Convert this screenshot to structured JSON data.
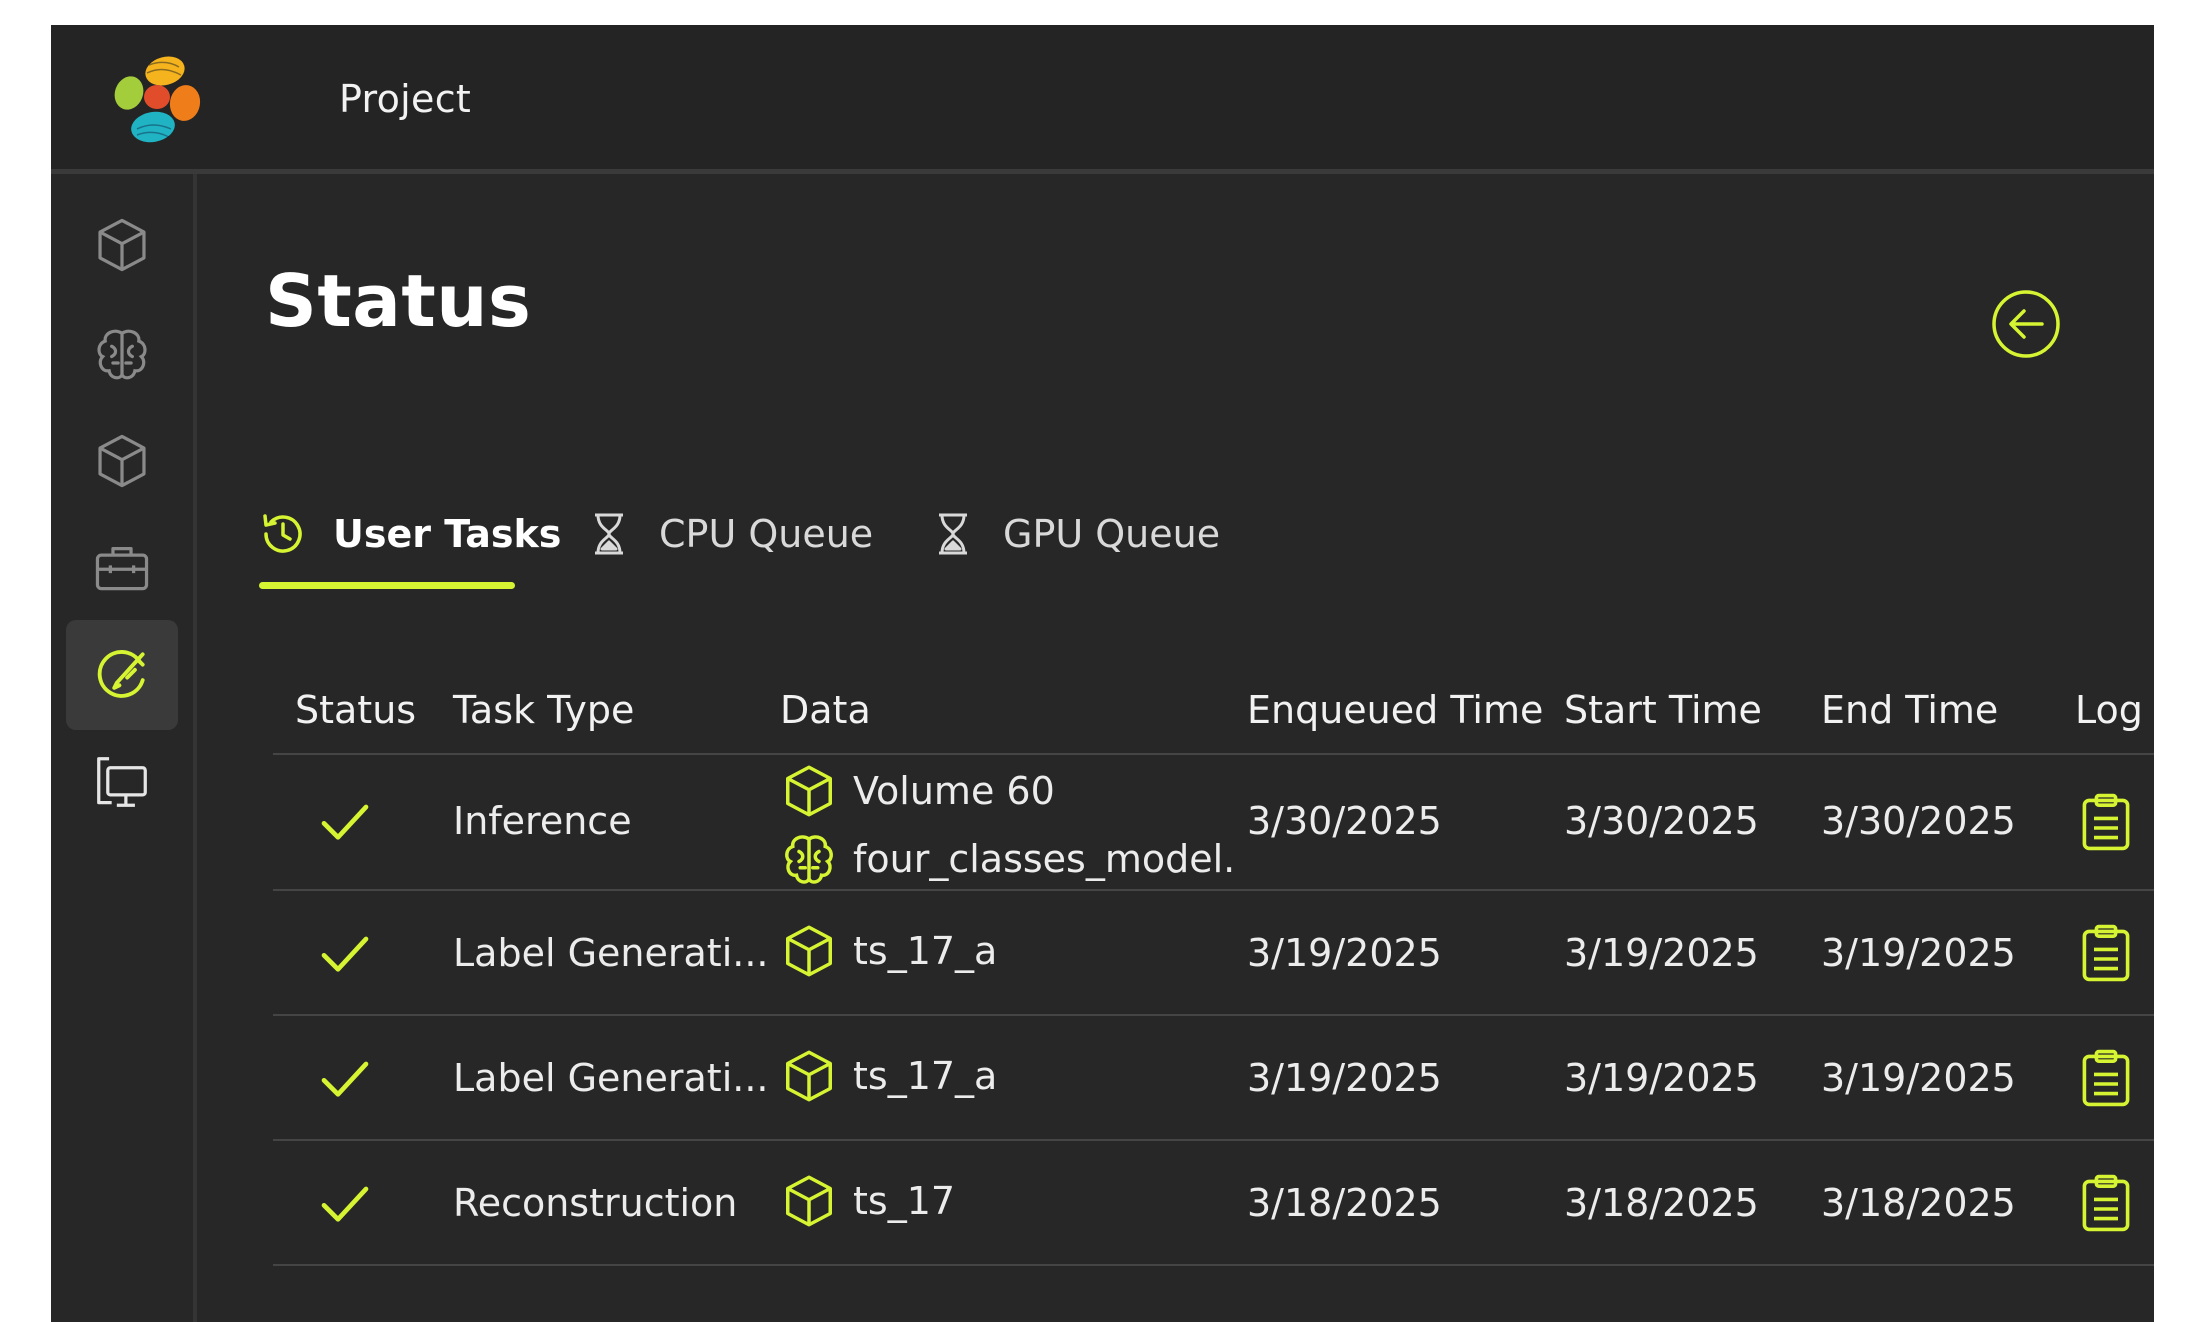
{
  "header": {
    "project_name": "Project"
  },
  "sidebar": {
    "items": [
      {
        "icon": "cube-icon",
        "active": false
      },
      {
        "icon": "brain-icon",
        "active": false
      },
      {
        "icon": "cube-icon",
        "active": false
      },
      {
        "icon": "toolbox-icon",
        "active": false
      },
      {
        "icon": "status-icon",
        "active": true
      },
      {
        "icon": "monitor-copy-icon",
        "active": false
      }
    ]
  },
  "page": {
    "title": "Status",
    "back_icon": "arrow-left-circle-icon"
  },
  "tabs": [
    {
      "label": "User Tasks",
      "icon": "history-icon",
      "active": true
    },
    {
      "label": "CPU Queue",
      "icon": "hourglass-icon",
      "active": false
    },
    {
      "label": "GPU Queue",
      "icon": "hourglass-icon",
      "active": false
    }
  ],
  "table": {
    "columns": [
      "Status",
      "Task Type",
      "Data",
      "Enqueued Time",
      "Start Time",
      "End Time",
      "Log"
    ],
    "rows": [
      {
        "status": "completed",
        "task_type": "Inference",
        "data": [
          {
            "icon": "cube-icon",
            "label": "Volume 60"
          },
          {
            "icon": "brain-icon",
            "label": "four_classes_model."
          }
        ],
        "enqueued": "3/30/2025",
        "start": "3/30/2025",
        "end": "3/30/2025"
      },
      {
        "status": "completed",
        "task_type": "Label Generati...",
        "data": [
          {
            "icon": "cube-icon",
            "label": "ts_17_a"
          }
        ],
        "enqueued": "3/19/2025",
        "start": "3/19/2025",
        "end": "3/19/2025"
      },
      {
        "status": "completed",
        "task_type": "Label Generati...",
        "data": [
          {
            "icon": "cube-icon",
            "label": "ts_17_a"
          }
        ],
        "enqueued": "3/19/2025",
        "start": "3/19/2025",
        "end": "3/19/2025"
      },
      {
        "status": "completed",
        "task_type": "Reconstruction",
        "data": [
          {
            "icon": "cube-icon",
            "label": "ts_17"
          }
        ],
        "enqueued": "3/18/2025",
        "start": "3/18/2025",
        "end": "3/18/2025"
      }
    ]
  },
  "colors": {
    "accent": "#d7f432",
    "background": "#272727",
    "topbar": "#242424",
    "inactive_icon": "#8a8a8a"
  }
}
